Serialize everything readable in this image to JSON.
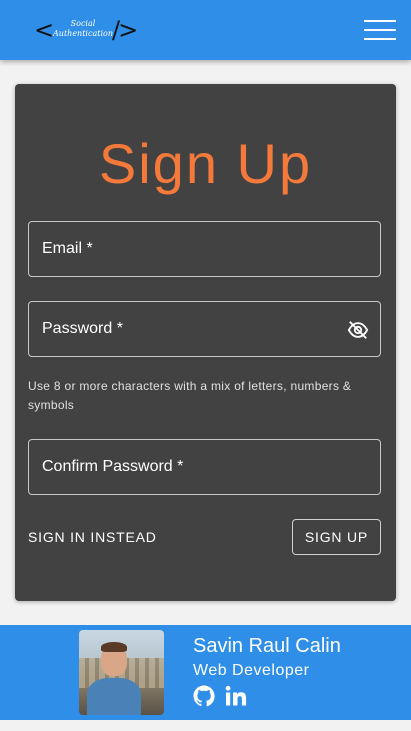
{
  "header": {
    "logo_text_line1": "Social",
    "logo_text_line2": "Authentication",
    "logo_bracket_left": "<",
    "logo_bracket_right": "/>",
    "menu_icon": "hamburger-menu-icon",
    "color": "#2f8fe8"
  },
  "form": {
    "title": "Sign Up",
    "email_label": "Email *",
    "password_label": "Password *",
    "password_visibility_icon": "eye-off-icon",
    "password_hint": "Use 8 or more characters with a mix of letters, numbers & symbols",
    "confirm_password_label": "Confirm Password *",
    "sign_in_instead": "SIGN IN INSTEAD",
    "sign_up_button": "SIGN UP",
    "title_color": "#f4793b",
    "card_color": "#424242"
  },
  "footer": {
    "name": "Savin Raul Calin",
    "role": "Web Developer",
    "icons": [
      "github-icon",
      "linkedin-icon"
    ]
  }
}
